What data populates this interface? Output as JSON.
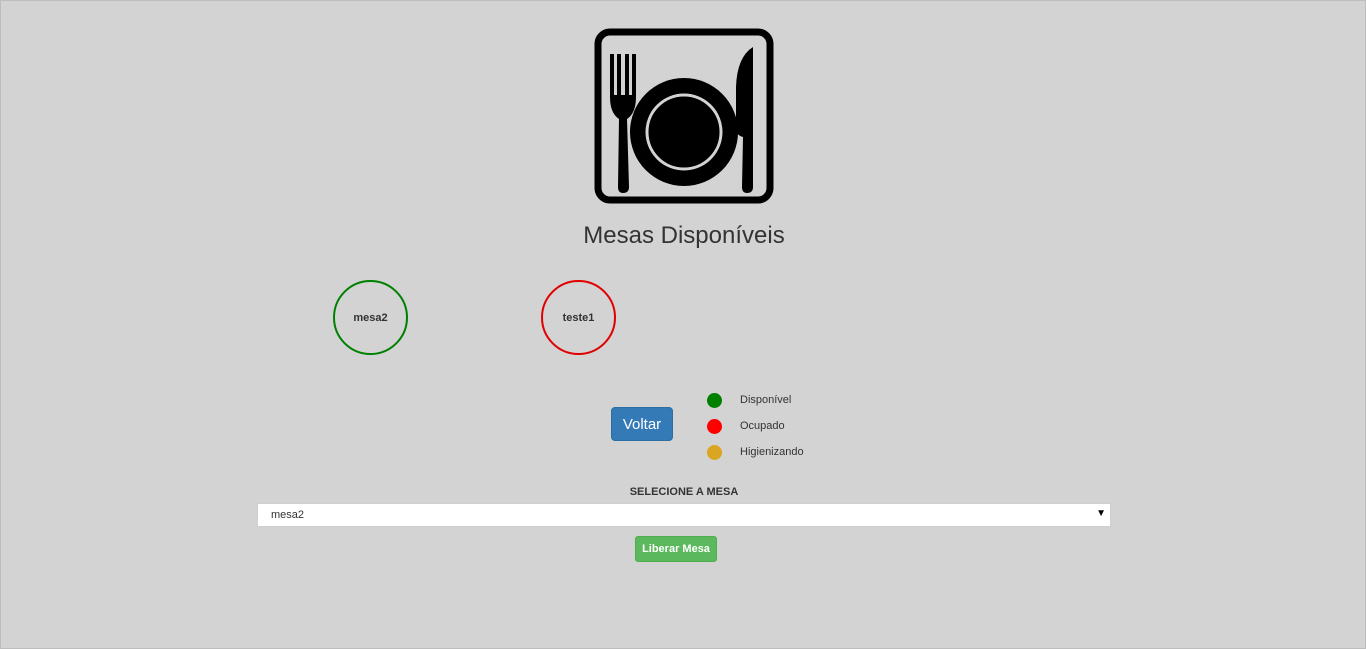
{
  "header": {
    "title": "Mesas Disponíveis",
    "logo_icon": "restaurant-plate-icon"
  },
  "tables": [
    {
      "name": "mesa2",
      "status": "Disponível",
      "color": "#008000"
    },
    {
      "name": "teste1",
      "status": "Ocupado",
      "color": "#e00000"
    }
  ],
  "back_button": {
    "label": "Voltar",
    "color": "#337ab7"
  },
  "legend": [
    {
      "label": "Disponível",
      "color": "#008000"
    },
    {
      "label": "Ocupado",
      "color": "#ff0000"
    },
    {
      "label": "Higienizando",
      "color": "#daa520"
    }
  ],
  "select": {
    "label": "SELECIONE A MESA",
    "value": "mesa2",
    "arrow_icon": "caret-down-icon"
  },
  "release_button": {
    "label": "Liberar Mesa",
    "color": "#5cb85c"
  }
}
